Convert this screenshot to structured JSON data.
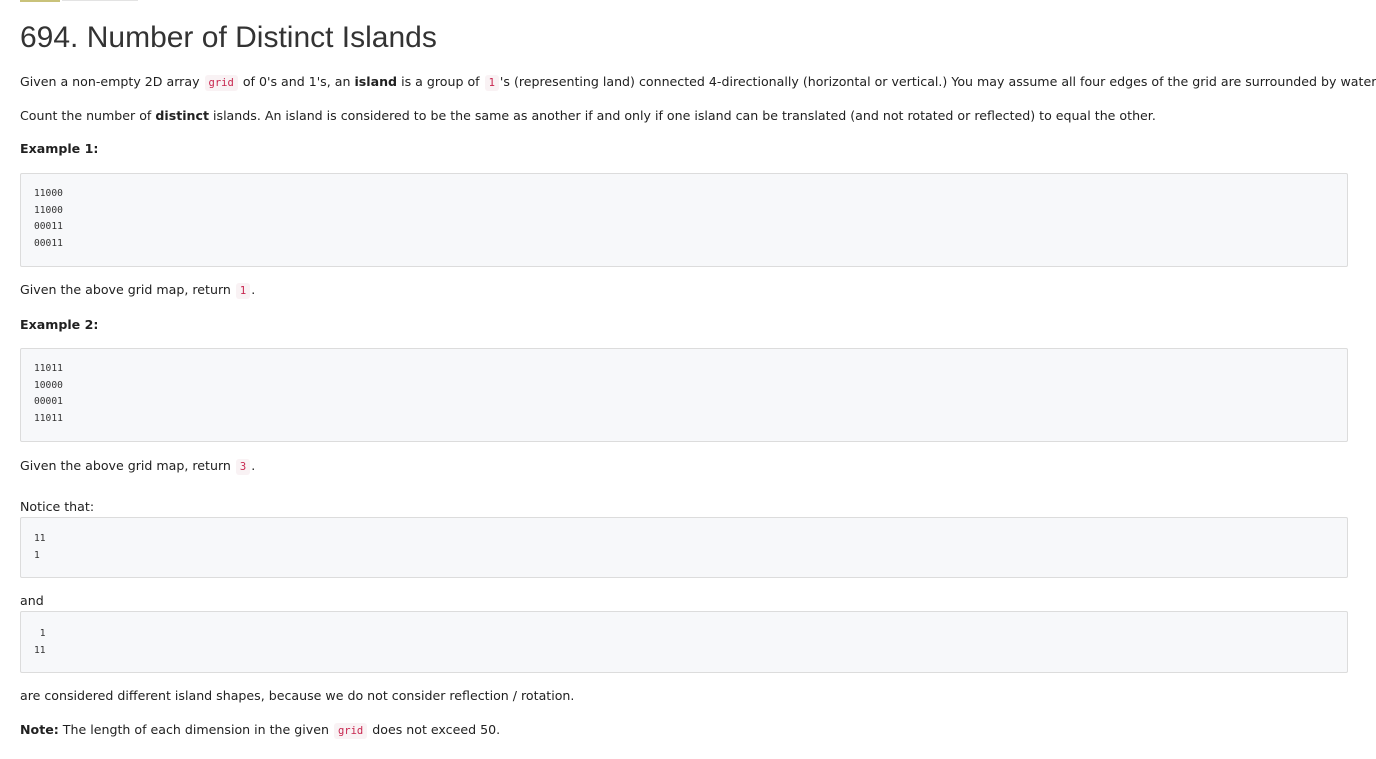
{
  "problem": {
    "title": "694. Number of Distinct Islands"
  },
  "description": {
    "p1": {
      "t1": "Given a non-empty 2D array ",
      "c1": "grid",
      "t2": " of 0's and 1's, an ",
      "b1": "island",
      "t3": " is a group of ",
      "c2": "1",
      "t4": "'s (representing land) connected 4-directionally (horizontal or vertical.) You may assume all four edges of the grid are surrounded by water."
    },
    "p2": {
      "t1": "Count the number of ",
      "b1": "distinct",
      "t2": " islands. An island is considered to be the same as another if and only if one island can be translated (and not rotated or reflected) to equal the other."
    }
  },
  "example1": {
    "heading": "Example 1:",
    "grid": "11000\n11000\n00011\n00011",
    "result_text": "Given the above grid map, return ",
    "result_value": "1",
    "result_end": "."
  },
  "example2": {
    "heading": "Example 2:",
    "grid": "11011\n10000\n00001\n11011",
    "result_text": "Given the above grid map, return ",
    "result_value": "3",
    "result_end": "."
  },
  "notice": {
    "label": "Notice that:",
    "shape1": "11\n1",
    "connector": "and",
    "shape2": " 1\n11",
    "explanation": "are considered different island shapes, because we do not consider reflection / rotation."
  },
  "note": {
    "label": "Note:",
    "t1": " The length of each dimension in the given ",
    "code": "grid",
    "t2": " does not exceed 50."
  }
}
